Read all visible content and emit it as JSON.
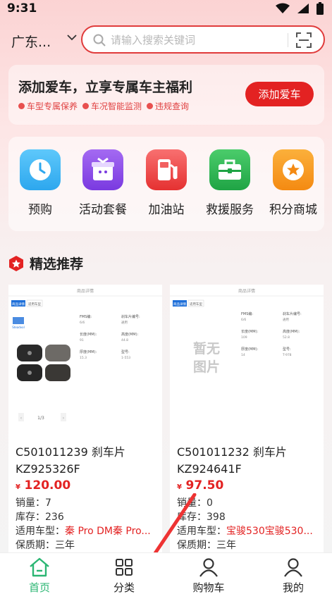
{
  "status": {
    "time": "9:31"
  },
  "header": {
    "city": "广东...",
    "search_placeholder": "请输入搜索关键词"
  },
  "banner": {
    "title": "添加爱车，立享专属车主福利",
    "tags": [
      "车型专属保养",
      "车况智能监测",
      "违规查询"
    ],
    "button": "添加爱车"
  },
  "services": [
    {
      "label": "预购",
      "color": "#3bb6f2",
      "icon": "clock-icon"
    },
    {
      "label": "活动套餐",
      "color": "#8a4bea",
      "icon": "gift-box-icon"
    },
    {
      "label": "加油站",
      "color": "#ee4444",
      "icon": "fuel-pump-icon"
    },
    {
      "label": "救援服务",
      "color": "#27b24d",
      "icon": "toolbox-icon"
    },
    {
      "label": "积分商城",
      "color": "#f79a1c",
      "icon": "star-coin-icon"
    }
  ],
  "section": {
    "title": "精选推荐"
  },
  "products": [
    {
      "img_header": "商品详情",
      "img_tabs": [
        "商品详情",
        "适用车型"
      ],
      "brand": "Steadvol",
      "specs": [
        {
          "k": "FMS编:",
          "v": "6/6"
        },
        {
          "k": "刹车片编号:",
          "v": "通用"
        },
        {
          "k": "长度(MM):",
          "v": "91"
        },
        {
          "k": "高度(MM):",
          "v": "44.8"
        },
        {
          "k": "厚度(MM):",
          "v": "15.3"
        },
        {
          "k": "型号:",
          "v": "1-553"
        }
      ],
      "pager": "1/3",
      "placeholder": "",
      "name": "C501011239 刹车片 KZ925326F",
      "currency": "¥",
      "price": "120.00",
      "sales_label": "销量：",
      "sales": "7",
      "stock_label": "库存：",
      "stock": "236",
      "models_label": "适用车型：",
      "models": "秦 Pro DM秦 Pro...",
      "warranty_label": "保质期：",
      "warranty": "三年"
    },
    {
      "img_header": "商品详情",
      "img_tabs": [
        "商品详情",
        "适用车型"
      ],
      "brand": "",
      "specs": [
        {
          "k": "FMS编:",
          "v": "6/6"
        },
        {
          "k": "刹车片编号:",
          "v": "通用"
        },
        {
          "k": "长度(MM):",
          "v": "109"
        },
        {
          "k": "高度(MM):",
          "v": "52.8"
        },
        {
          "k": "厚度(MM):",
          "v": "14"
        },
        {
          "k": "型号:",
          "v": "T-978"
        }
      ],
      "pager": "",
      "placeholder": "暂无图片",
      "name": "C501011232 刹车片 KZ924641F",
      "currency": "¥",
      "price": "97.50",
      "sales_label": "销量：",
      "sales": "0",
      "stock_label": "库存：",
      "stock": "398",
      "models_label": "适用车型：",
      "models": "宝骏530宝骏530...",
      "warranty_label": "保质期：",
      "warranty": "三年"
    }
  ],
  "tabbar": [
    {
      "label": "首页",
      "icon": "home-icon",
      "active": true
    },
    {
      "label": "分类",
      "icon": "grid-icon",
      "active": false
    },
    {
      "label": "购物车",
      "icon": "person-icon",
      "active": false
    },
    {
      "label": "我的",
      "icon": "person-icon",
      "active": false
    }
  ],
  "colors": {
    "accent": "#e32222",
    "active_tab": "#2bb673",
    "text": "#222222"
  }
}
